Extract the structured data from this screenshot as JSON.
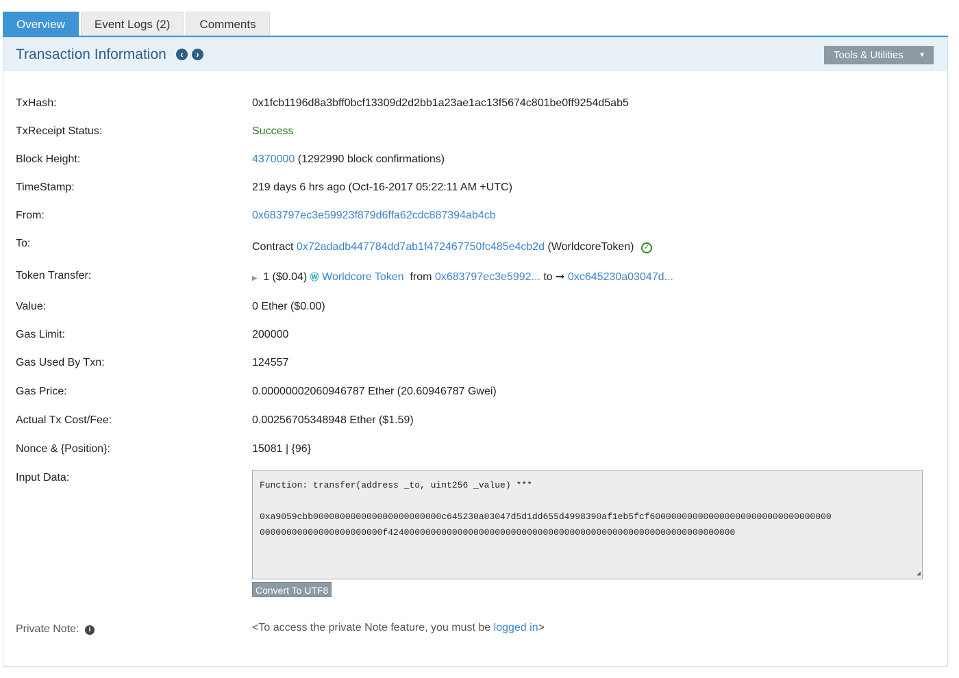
{
  "tabs": [
    {
      "label": "Overview"
    },
    {
      "label": "Event Logs (2)"
    },
    {
      "label": "Comments"
    }
  ],
  "header": {
    "title": "Transaction Information",
    "tools_label": "Tools & Utilities"
  },
  "fields": {
    "txhash": {
      "label": "TxHash:",
      "value": "0x1fcb1196d8a3bff0bcf13309d2d2bb1a23ae1ac13f5674c801be0ff9254d5ab5"
    },
    "status": {
      "label": "TxReceipt Status:",
      "value": "Success"
    },
    "block": {
      "label": "Block Height:",
      "link": "4370000",
      "suffix": "(1292990 block confirmations)"
    },
    "timestamp": {
      "label": "TimeStamp:",
      "value": "219 days 6 hrs ago (Oct-16-2017 05:22:11 AM +UTC)"
    },
    "from": {
      "label": "From:",
      "link": "0x683797ec3e59923f879d6ffa62cdc887394ab4cb"
    },
    "to": {
      "label": "To:",
      "prefix": "Contract",
      "link": "0x72adadb447784dd7ab1f472467750fc485e4cb2d",
      "suffix": "(WorldcoreToken)"
    },
    "token_transfer": {
      "label": "Token Transfer:",
      "amount": "1 ($0.04)",
      "token_name": "Worldcore Token",
      "from_label": "from",
      "from_link": "0x683797ec3e5992...",
      "to_label": "to",
      "to_link": "0xc645230a03047d..."
    },
    "value": {
      "label": "Value:",
      "value": "0 Ether ($0.00)"
    },
    "gas_limit": {
      "label": "Gas Limit:",
      "value": "200000"
    },
    "gas_used": {
      "label": "Gas Used By Txn:",
      "value": "124557"
    },
    "gas_price": {
      "label": "Gas Price:",
      "value": "0.00000002060946787 Ether (20.60946787 Gwei)"
    },
    "fee": {
      "label": "Actual Tx Cost/Fee:",
      "value": "0.00256705348948 Ether ($1.59)"
    },
    "nonce": {
      "label": "Nonce & {Position}:",
      "value": "15081 | {96}"
    },
    "input_data": {
      "label": "Input Data:",
      "function": "Function: transfer(address _to, uint256 _value) ***",
      "line1": "0xa9059cbb000000000000000000000000c645230a03047d5d1dd655d4998390af1eb5fcf6000000000000000000000000000000000",
      "line2": "00000000000000000000000f42400000000000000000000000000000000000000000000000000000000000000",
      "convert_label": "Convert To UTF8"
    },
    "private_note": {
      "label": "Private Note:",
      "text_before": "<To access the private Note feature, you must be ",
      "link": "logged in",
      "text_after": ">"
    }
  },
  "icons": {
    "prev": "chevron-left-icon",
    "next": "chevron-right-icon",
    "check": "verified-check-icon",
    "info": "info-icon"
  },
  "colors": {
    "accent": "#3e94d4",
    "link": "#3a84cb",
    "success": "#2b7a1e",
    "header_bg": "#e8f1f8"
  }
}
